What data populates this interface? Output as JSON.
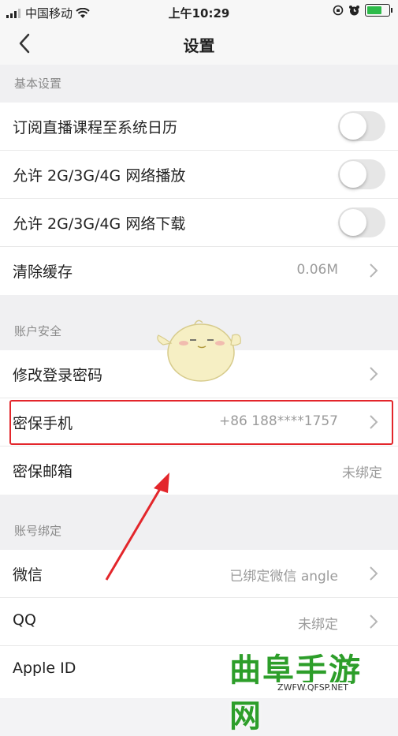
{
  "status_bar": {
    "carrier": "中国移动",
    "time": "上午10:29"
  },
  "nav": {
    "title": "设置"
  },
  "sections": {
    "basic": {
      "header": "基本设置",
      "rows": [
        {
          "label": "订阅直播课程至系统日历",
          "toggle": false
        },
        {
          "label": "允许 2G/3G/4G 网络播放",
          "toggle": false
        },
        {
          "label": "允许 2G/3G/4G 网络下载",
          "toggle": false
        },
        {
          "label": "清除缓存",
          "value": "0.06M"
        }
      ]
    },
    "security": {
      "header": "账户安全",
      "rows": [
        {
          "label": "修改登录密码",
          "value": ""
        },
        {
          "label": "密保手机",
          "value": "+86 188****1757"
        },
        {
          "label": "密保邮箱",
          "value": "未绑定"
        }
      ]
    },
    "binding": {
      "header": "账号绑定",
      "rows": [
        {
          "label": "微信",
          "value": "已绑定微信 angle"
        },
        {
          "label": "QQ",
          "value": "未绑定"
        },
        {
          "label": "Apple ID",
          "value": ""
        }
      ]
    }
  },
  "watermark": {
    "title": "曲阜手游网",
    "url": "ZWFW.QFSP.NET"
  },
  "colors": {
    "highlight": "#e3262b",
    "watermark": "#2d9e2a",
    "toggle_off": "#e6e6e6"
  }
}
